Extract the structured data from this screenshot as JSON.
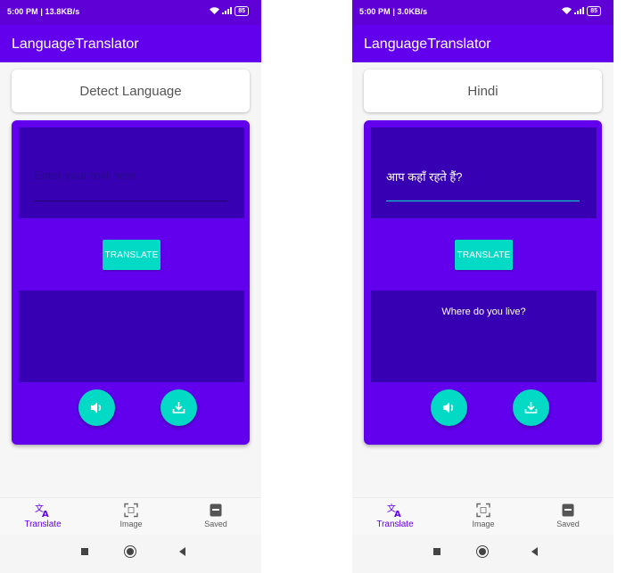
{
  "app": {
    "title": "LanguageTranslator",
    "colors": {
      "primary": "#6200ee",
      "primary_dark": "#3700b3",
      "accent": "#03dac5",
      "status_bar": "#5e00d6"
    }
  },
  "left": {
    "status": {
      "time": "5:00 PM | 13.8KB/s",
      "battery": "85"
    },
    "language": "Detect Language",
    "input": {
      "placeholder": "Enter your text here",
      "value": ""
    },
    "translate_label": "TRANSLATE",
    "output": "",
    "fabs": {
      "speak_icon": "volume-icon",
      "save_icon": "download-icon"
    },
    "nav": [
      {
        "label": "Translate",
        "icon": "translate-icon",
        "active": true
      },
      {
        "label": "Image",
        "icon": "image-scan-icon",
        "active": false
      },
      {
        "label": "Saved",
        "icon": "saved-box-icon",
        "active": false
      }
    ]
  },
  "right": {
    "status": {
      "time": "5:00 PM | 3.0KB/s",
      "battery": "85"
    },
    "language": "Hindi",
    "input": {
      "placeholder": "",
      "value": "आप कहाँ रहते हैं?"
    },
    "translate_label": "TRANSLATE",
    "output": "Where do you live?",
    "fabs": {
      "speak_icon": "volume-icon",
      "save_icon": "download-icon"
    },
    "nav": [
      {
        "label": "Translate",
        "icon": "translate-icon",
        "active": true
      },
      {
        "label": "Image",
        "icon": "image-scan-icon",
        "active": false
      },
      {
        "label": "Saved",
        "icon": "saved-box-icon",
        "active": false
      }
    ]
  }
}
